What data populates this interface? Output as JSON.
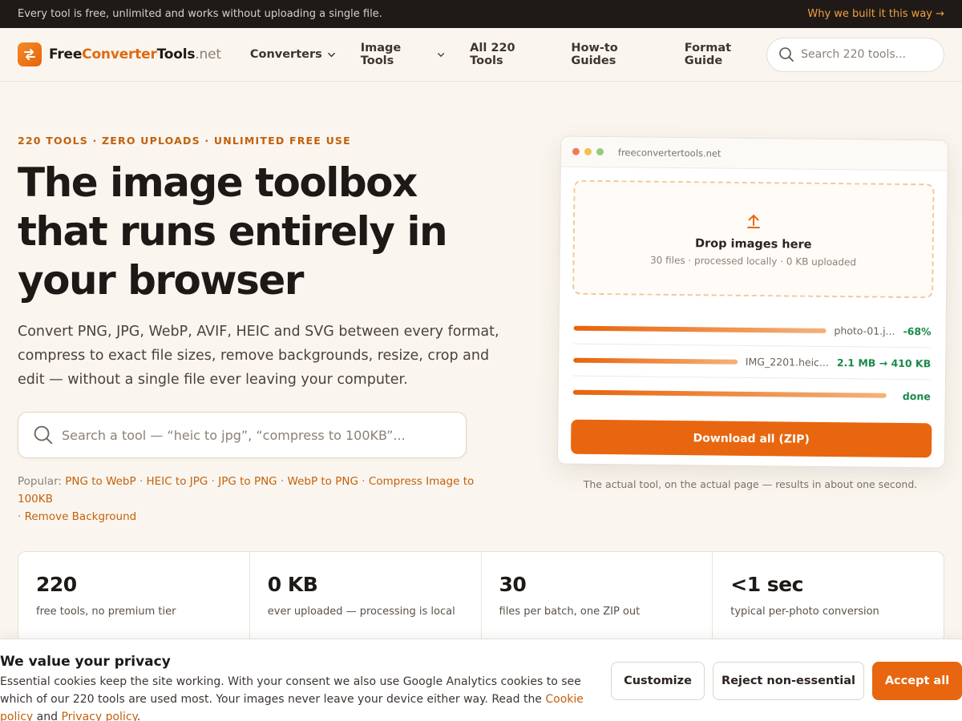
{
  "announcement": {
    "text": "Every tool is free, unlimited and works without uploading a single file.",
    "link": "Why we built it this way →"
  },
  "header": {
    "logo_part1": "Free",
    "logo_part2": "Converter",
    "logo_part3": "Tools",
    "logo_part4": ".net",
    "nav": [
      {
        "label": "Converters"
      },
      {
        "label": "Image Tools"
      },
      {
        "label": "All 220 Tools"
      },
      {
        "label": "How-to Guides"
      },
      {
        "label": "Format Guide"
      }
    ],
    "search_placeholder": "Search 220 tools..."
  },
  "hero": {
    "eyebrow": "220 TOOLS · ZERO UPLOADS · UNLIMITED FREE USE",
    "title": "The image toolbox that runs entirely in your browser",
    "subtitle": "Convert PNG, JPG, WebP, AVIF, HEIC and SVG between every format, compress to exact file sizes, remove backgrounds, resize, crop and edit — without a single file ever leaving your computer.",
    "search_placeholder": "Search a tool — “heic to jpg”, “compress to 100KB”...",
    "popular_label": "Popular:",
    "popular_links": [
      "PNG to WebP",
      "HEIC to JPG",
      "JPG to PNG",
      "WebP to PNG",
      "Compress Image to 100KB",
      "Remove Background"
    ]
  },
  "mock": {
    "url": "freeconvertertools.net",
    "drop_title": "Drop images here",
    "drop_sub": "30 files · processed locally · 0 KB uploaded",
    "rows": [
      {
        "name": "photo-01.j...",
        "result": "-68%"
      },
      {
        "name": "IMG_2201.heic...",
        "result": "2.1 MB → 410 KB"
      },
      {
        "name": "",
        "result": "done"
      }
    ],
    "download_label": "Download all (ZIP)",
    "caption": "The actual tool, on the actual page — results in about one second."
  },
  "stats": [
    {
      "value": "220",
      "label": "free tools, no premium tier"
    },
    {
      "value": "0 KB",
      "label": "ever uploaded — processing is local"
    },
    {
      "value": "30",
      "label": "files per batch, one ZIP out"
    },
    {
      "value": "<1 sec",
      "label": "typical per-photo conversion"
    }
  ],
  "cookie": {
    "title": "We value your privacy",
    "text_before": "Essential cookies keep the site working. With your consent we also use Google Analytics cookies to see which of our 220 tools are used most. Your images never leave your device either way. Read the ",
    "cookie_link": "Cookie policy",
    "and": " and ",
    "privacy_link": "Privacy policy",
    "period": ".",
    "customize": "Customize",
    "reject": "Reject non-essential",
    "accept": "Accept all"
  },
  "colors": {
    "accent": "#e8660f",
    "accent_text": "#c2600c",
    "success": "#1a8a4a",
    "topbar_bg": "#1f1a17",
    "page_bg": "#faf6ef"
  }
}
